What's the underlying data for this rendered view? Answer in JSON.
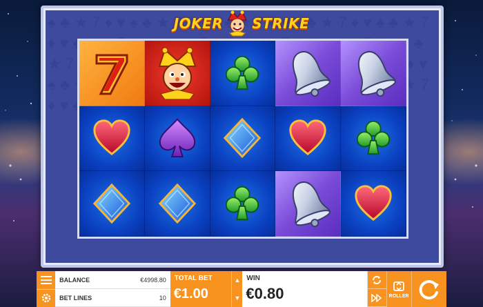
{
  "logo": {
    "word_left": "JOKER",
    "word_right": "STRIKE"
  },
  "reels": [
    [
      "seven",
      "jester",
      "club",
      "bell",
      "bell"
    ],
    [
      "heart",
      "spade",
      "diamond",
      "heart",
      "club"
    ],
    [
      "diamond",
      "diamond",
      "club",
      "bell",
      "heart"
    ]
  ],
  "bar": {
    "balance_label": "BALANCE",
    "balance_value": "€4998.80",
    "betlines_label": "BET LINES",
    "betlines_value": "10",
    "totalbet_label": "TOTAL BET",
    "totalbet_value": "€1.00",
    "win_label": "WIN",
    "win_value": "€0.80",
    "roller_label": "ROLLER"
  },
  "icons": {
    "menu": "menu-icon",
    "settings": "gear-icon",
    "autoplay": "autoplay-icon",
    "fast": "fast-forward-icon",
    "roller": "roller-icon",
    "spin": "spin-icon"
  },
  "colors": {
    "accent": "#f7931e",
    "reel_bg": "#0a3fbf",
    "frame": "#3d4a9e"
  }
}
